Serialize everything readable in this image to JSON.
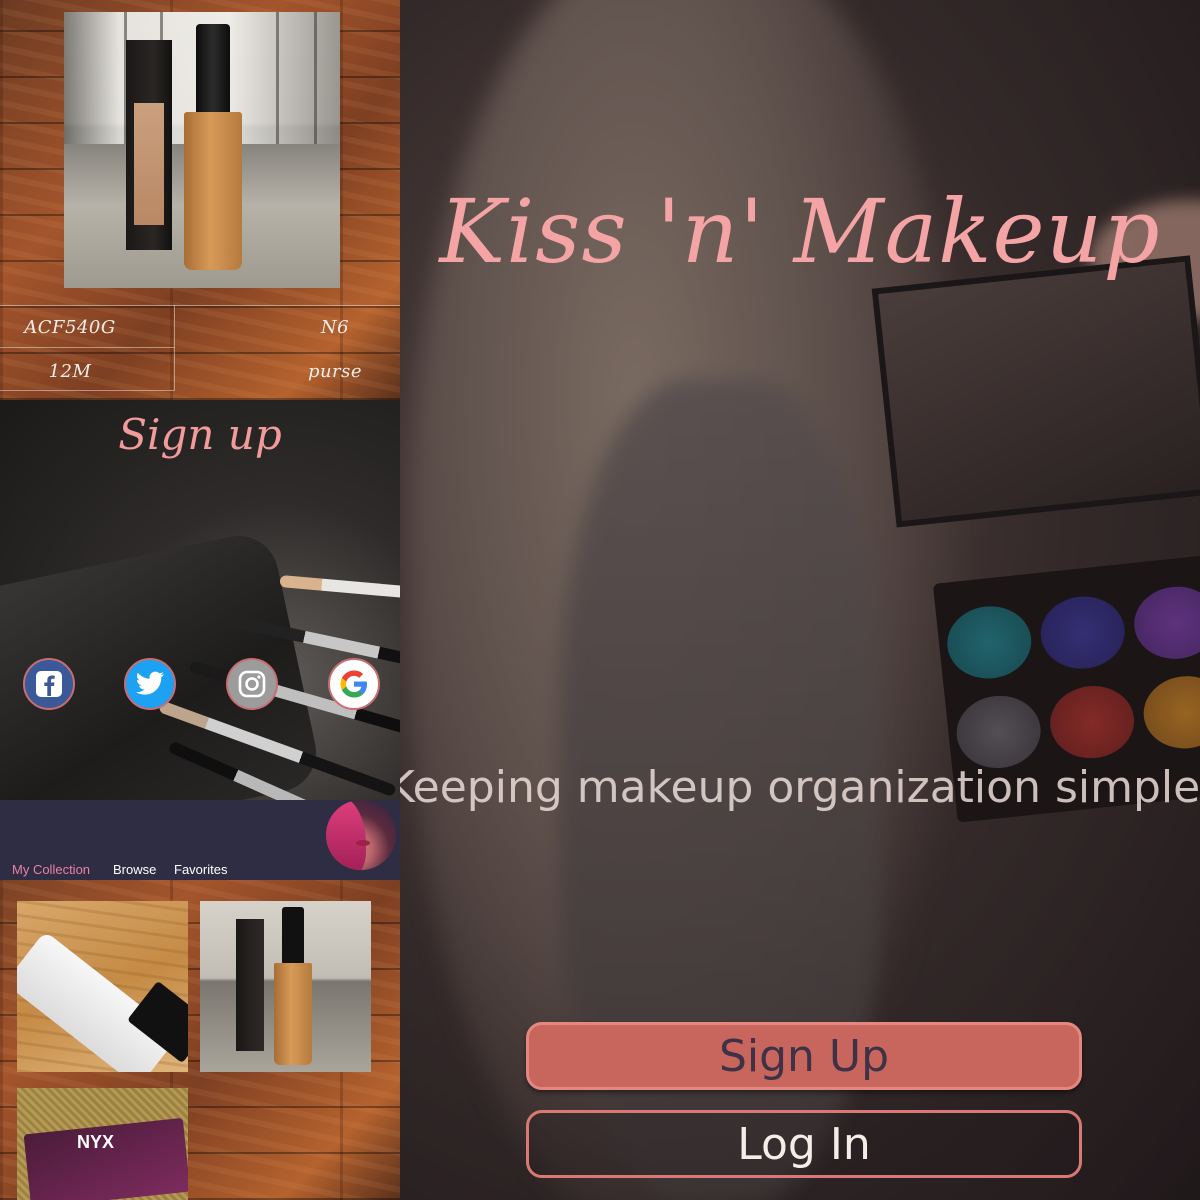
{
  "item_detail": {
    "cells": {
      "code": "ACF540G",
      "shade": "N6",
      "expiry": "12M",
      "location": "purse"
    }
  },
  "signup": {
    "title": "Sign up",
    "social_icons": [
      "facebook-icon",
      "twitter-icon",
      "instagram-icon",
      "google-icon"
    ]
  },
  "collection": {
    "tabs": [
      {
        "label": "My Collection",
        "active": true
      },
      {
        "label": "Browse",
        "active": false
      },
      {
        "label": "Favorites",
        "active": false
      }
    ],
    "accent_color": "#e882a6"
  },
  "landing": {
    "logo": "Kiss 'n' Makeup",
    "tagline": "Keeping makeup organization simple",
    "signup_button": "Sign Up",
    "login_button": "Log In",
    "logo_color": "#f5a4a6",
    "button_color": "#c8665e"
  }
}
